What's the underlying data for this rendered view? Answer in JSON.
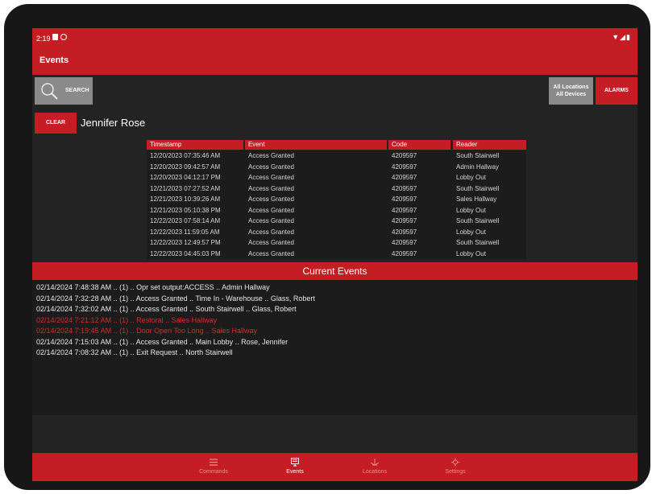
{
  "status_bar": {
    "time": "2:19",
    "right_icons": [
      "wifi-icon",
      "signal-icon",
      "battery-icon"
    ]
  },
  "app_bar": {
    "title": "Events"
  },
  "toolbar": {
    "search_label": "SEARCH",
    "locations_line1": "All Locations",
    "locations_line2": "All Devices",
    "alarms_label": "ALARMS",
    "clear_label": "CLEAR"
  },
  "filter": {
    "name": "Jennifer Rose"
  },
  "events_table": {
    "headers": [
      "Timestamp",
      "Event",
      "Code",
      "Reader"
    ],
    "rows": [
      [
        "12/20/2023 07:35:46 AM",
        "Access Granted",
        "4209597",
        "South Stairwell"
      ],
      [
        "12/20/2023 09:42:57 AM",
        "Access Granted",
        "4209597",
        "Admin Hallway"
      ],
      [
        "12/20/2023 04:12:17 PM",
        "Access Granted",
        "4209597",
        "Lobby Out"
      ],
      [
        "12/21/2023 07:27:52 AM",
        "Access Granted",
        "4209597",
        "South Stairwell"
      ],
      [
        "12/21/2023 10:39:26 AM",
        "Access Granted",
        "4209597",
        "Sales Hallway"
      ],
      [
        "12/21/2023 05:10:38 PM",
        "Access Granted",
        "4209597",
        "Lobby Out"
      ],
      [
        "12/22/2023 07:58:14 AM",
        "Access Granted",
        "4209597",
        "South Stairwell"
      ],
      [
        "12/22/2023 11:59:05 AM",
        "Access Granted",
        "4209597",
        "Lobby Out"
      ],
      [
        "12/22/2023 12:49:57 PM",
        "Access Granted",
        "4209597",
        "South Stairwell"
      ],
      [
        "12/22/2023 04:45:03 PM",
        "Access Granted",
        "4209597",
        "Lobby Out"
      ]
    ]
  },
  "current_events": {
    "title": "Current Events",
    "items": [
      {
        "text": "02/14/2024 7:48:38 AM .. (1) .. Opr set output:ACCESS .. Admin Hallway",
        "alert": false
      },
      {
        "text": "02/14/2024 7:32:28 AM .. (1) .. Access Granted .. Time In - Warehouse .. Glass, Robert",
        "alert": false
      },
      {
        "text": "02/14/2024 7:32:02 AM .. (1) .. Access Granted .. South Stairwell .. Glass, Robert",
        "alert": false
      },
      {
        "text": "02/14/2024 7:21:12 AM .. (1) .. Restoral .. Sales Hallway",
        "alert": true
      },
      {
        "text": "02/14/2024 7:19:45 AM .. (1) .. Door Open Too Long .. Sales Hallway",
        "alert": true
      },
      {
        "text": "02/14/2024 7:15:03 AM .. (1) .. Access Granted .. Main Lobby .. Rose, Jennifer",
        "alert": false
      },
      {
        "text": "02/14/2024 7:08:32 AM .. (1) .. Exit Request .. North Stairwell",
        "alert": false
      }
    ]
  },
  "bottom_nav": {
    "items": [
      {
        "label": "Commands",
        "icon": "list-icon",
        "active": false
      },
      {
        "label": "Events",
        "icon": "events-icon",
        "active": true
      },
      {
        "label": "Locations",
        "icon": "location-icon",
        "active": false
      },
      {
        "label": "Settings",
        "icon": "settings-icon",
        "active": false
      }
    ]
  },
  "colors": {
    "accent": "#c41e24",
    "alert_text": "#d42a2a",
    "background": "#232323"
  }
}
